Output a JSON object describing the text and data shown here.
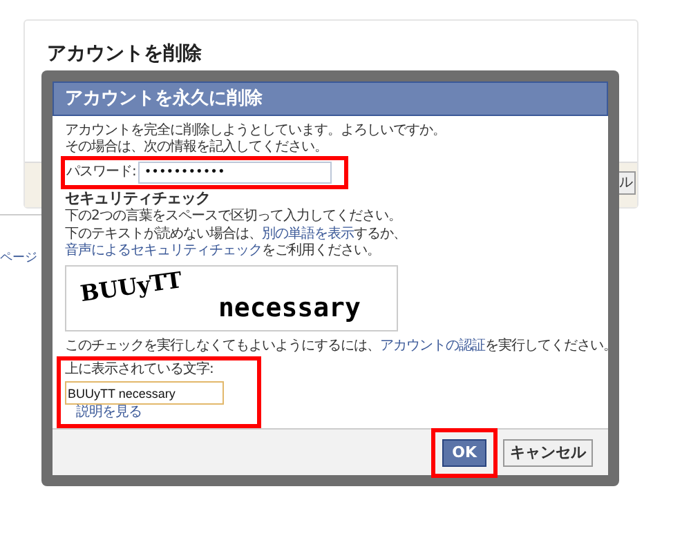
{
  "background_page": {
    "title": "アカウントを削除",
    "partial_button": "ル",
    "side_text": "ページ"
  },
  "dialog": {
    "title": "アカウントを永久に削除",
    "intro": [
      "アカウントを完全に削除しようとしています。よろしいですか。",
      "その場合は、次の情報を記入してください。"
    ],
    "password": {
      "label": "パスワード:",
      "value": "•••••••••••",
      "highlighted": true
    },
    "security_heading": "セキュリティチェック",
    "instructions": [
      [
        {
          "text": "下の2つの言葉をスペースで区切って入力してください。",
          "link": false
        }
      ],
      [
        {
          "text": "下のテキストが読めない場合は、",
          "link": false
        },
        {
          "text": "別の単語を表示",
          "link": true
        },
        {
          "text": "するか、",
          "link": false
        },
        {
          "text": "音声によるセキュリティチェック",
          "link": true
        },
        {
          "text": "をご利用ください。",
          "link": false
        }
      ]
    ],
    "captcha_words": [
      "BUUyTT",
      "necessary"
    ],
    "verify_note": [
      {
        "text": "このチェックを実行しなくてもよいようにするには、",
        "link": false
      },
      {
        "text": "アカウントの認証",
        "link": true
      },
      {
        "text": "を実行してください。",
        "link": false
      }
    ],
    "captcha_field": {
      "label": "上に表示されている文字:",
      "value": "BUUyTT necessary",
      "highlighted": true
    },
    "help_link": "説明を見る",
    "buttons": [
      {
        "label": "OK",
        "kind": "primary",
        "highlighted": true
      },
      {
        "label": "キャンセル",
        "kind": "secondary",
        "highlighted": false
      }
    ]
  }
}
